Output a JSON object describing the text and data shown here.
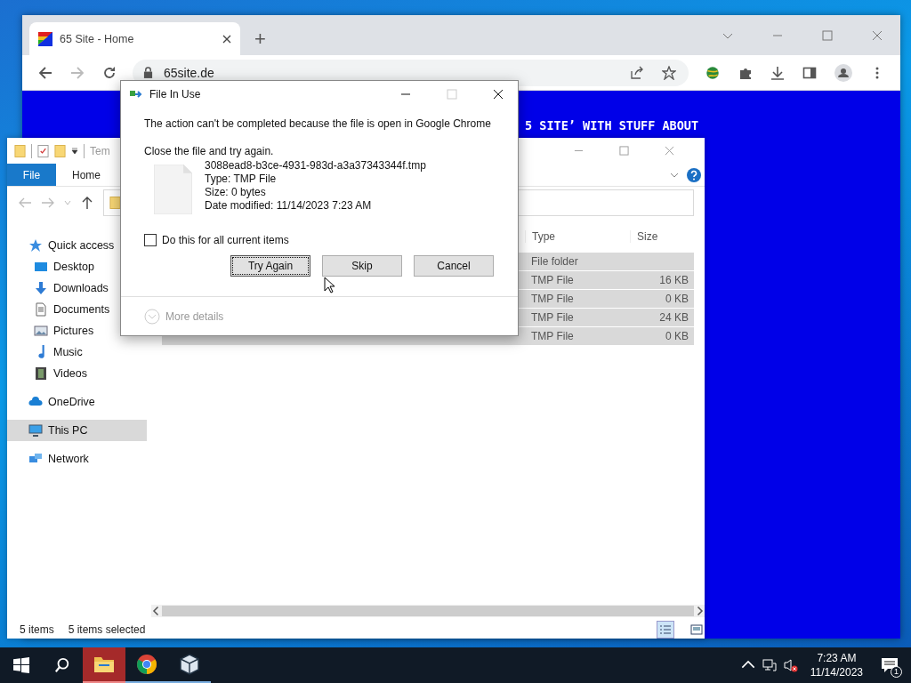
{
  "browser": {
    "tab": {
      "title": "65 Site - Home"
    },
    "new_tab": "+",
    "url": "65site.de",
    "forward_disabled": true,
    "page_text": "5 SITE’ WITH STUFF ABOUT"
  },
  "explorer": {
    "title_fragment": "Tem",
    "ribbon_tabs": [
      {
        "label": "File",
        "kind": "file"
      },
      {
        "label": "Home",
        "kind": "tab"
      }
    ],
    "sidebar": [
      {
        "label": "Quick access",
        "selected": false,
        "children": [
          {
            "label": "Desktop",
            "selected": false
          },
          {
            "label": "Downloads",
            "selected": false
          },
          {
            "label": "Documents",
            "selected": false
          },
          {
            "label": "Pictures",
            "selected": false
          },
          {
            "label": "Music",
            "selected": false
          },
          {
            "label": "Videos",
            "selected": false
          }
        ]
      },
      {
        "label": "OneDrive",
        "selected": false
      },
      {
        "label": "This PC",
        "selected": true
      },
      {
        "label": "Network",
        "selected": false
      }
    ],
    "columns": [
      "Type",
      "Size"
    ],
    "rows": [
      {
        "type": "File folder",
        "selected": true
      },
      {
        "type": "TMP File",
        "size": "16 KB",
        "selected": true
      },
      {
        "type": "TMP File",
        "size": "0 KB",
        "selected": true
      },
      {
        "type": "TMP File",
        "size": "24 KB",
        "selected": true
      },
      {
        "type": "TMP File",
        "size": "0 KB",
        "selected": true
      }
    ],
    "status": {
      "count": "5 items",
      "selection": "5 items selected"
    }
  },
  "dialog": {
    "title": "File In Use",
    "message": "The action can't be completed because the file is open in Google Chrome",
    "instruction": "Close the file and try again.",
    "file": {
      "name": "3088ead8-b3ce-4931-983d-a3a37343344f.tmp",
      "details": [
        "Type: TMP File",
        "Size: 0 bytes",
        "Date modified: 11/14/2023 7:23 AM"
      ]
    },
    "apply_all": {
      "label": "Do this for all current items",
      "checked": false
    },
    "buttons": [
      {
        "label": "Try Again",
        "focused": true
      },
      {
        "label": "Skip",
        "focused": false
      },
      {
        "label": "Cancel",
        "focused": false
      }
    ],
    "more_details": "More details"
  },
  "taskbar": {
    "apps": [
      {
        "kind": "explorer",
        "active": true
      },
      {
        "kind": "chrome",
        "active": false
      },
      {
        "kind": "cube",
        "active": false
      }
    ],
    "time": "7:23 AM",
    "date": "11/14/2023",
    "notifications": "1"
  }
}
